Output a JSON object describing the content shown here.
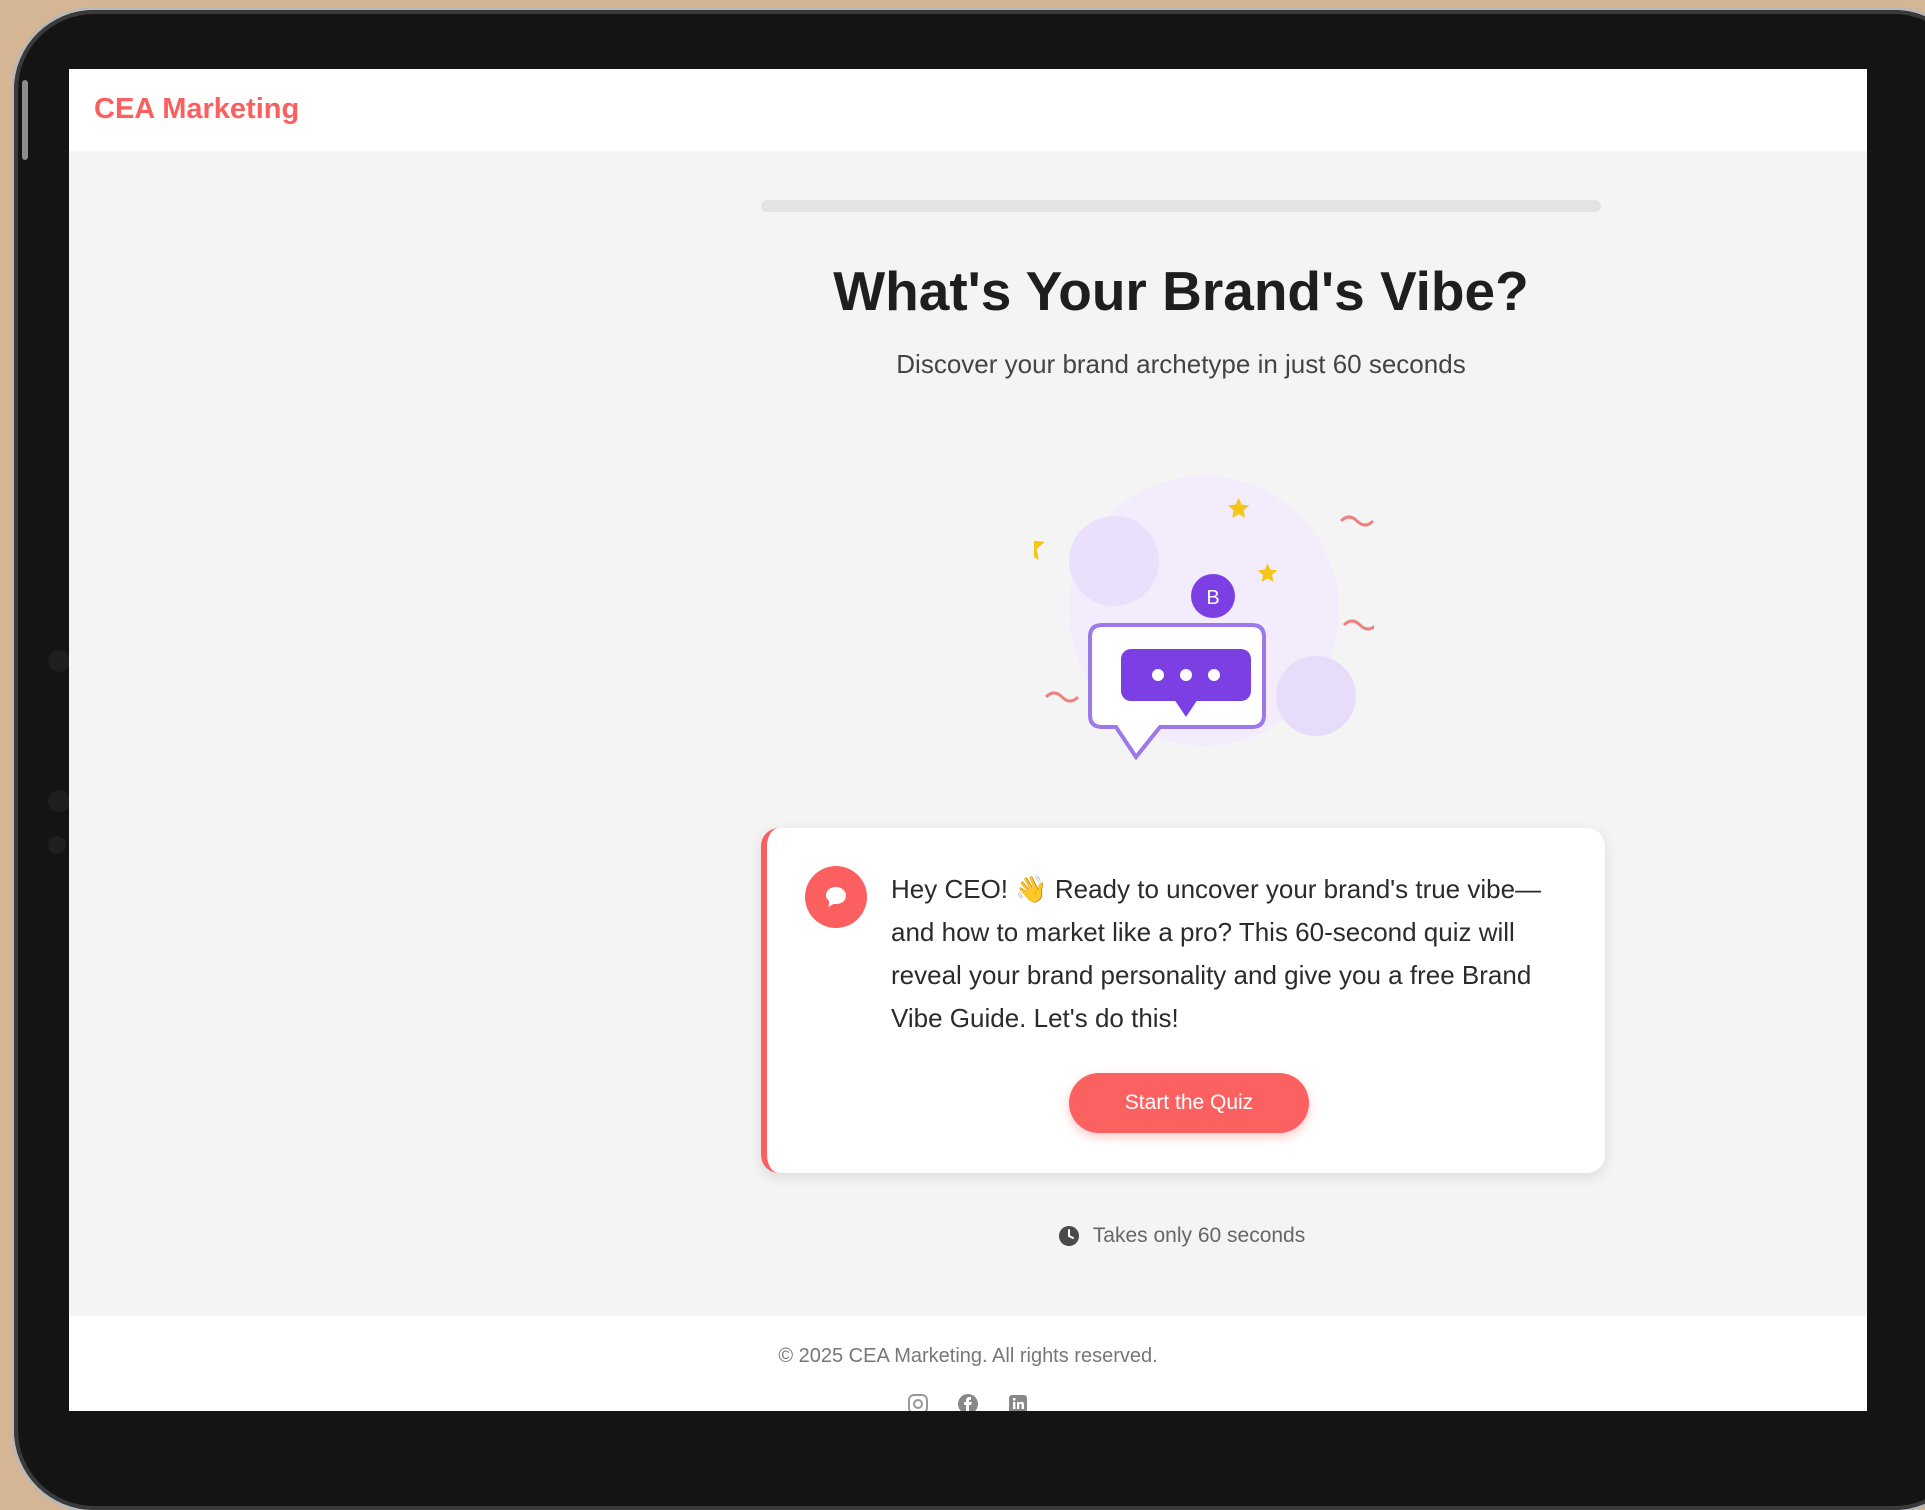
{
  "header": {
    "brand": "CEA Marketing"
  },
  "progress": {
    "percent": 0
  },
  "hero": {
    "title": "What's Your Brand's Vibe?",
    "subtitle": "Discover your brand archetype in just 60 seconds",
    "illustration_badge": "B"
  },
  "card": {
    "message": "Hey CEO! 👋 Ready to uncover your brand's true vibe—and how to market like a pro? This 60-second quiz will reveal your brand personality and give you a free Brand Vibe Guide. Let's do this!",
    "cta_label": "Start the Quiz"
  },
  "note": {
    "text": "Takes only 60 seconds"
  },
  "footer": {
    "copyright": "© 2025 CEA Marketing. All rights reserved.",
    "socials": [
      "instagram-icon",
      "facebook-icon",
      "linkedin-icon"
    ]
  },
  "colors": {
    "accent": "#fb5f5f",
    "illustration": "#7b3fe4",
    "star": "#f5c518"
  }
}
